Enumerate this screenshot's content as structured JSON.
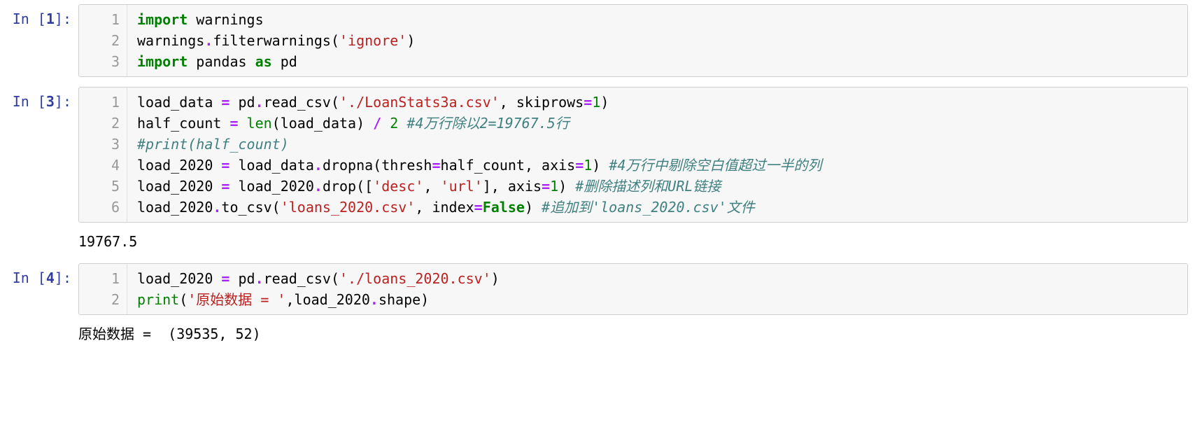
{
  "cells": [
    {
      "prompt_prefix": "In [",
      "prompt_num": "1",
      "prompt_suffix": "]:",
      "gutter": [
        "1",
        "2",
        "3"
      ],
      "tokens": [
        [
          [
            "kw",
            "import"
          ],
          [
            "id",
            " warnings"
          ]
        ],
        [
          [
            "id",
            "warnings"
          ],
          [
            "op",
            "."
          ],
          [
            "id",
            "filterwarnings"
          ],
          [
            "id",
            "("
          ],
          [
            "str",
            "'ignore'"
          ],
          [
            "id",
            ")"
          ]
        ],
        [
          [
            "kw",
            "import"
          ],
          [
            "id",
            " pandas "
          ],
          [
            "kw",
            "as"
          ],
          [
            "id",
            " pd"
          ]
        ]
      ],
      "output": null
    },
    {
      "prompt_prefix": "In [",
      "prompt_num": "3",
      "prompt_suffix": "]:",
      "gutter": [
        "1",
        "2",
        "3",
        "4",
        "5",
        "6"
      ],
      "tokens": [
        [
          [
            "id",
            "load_data "
          ],
          [
            "op",
            "="
          ],
          [
            "id",
            " pd"
          ],
          [
            "op",
            "."
          ],
          [
            "id",
            "read_csv("
          ],
          [
            "str",
            "'./LoanStats3a.csv'"
          ],
          [
            "id",
            ", skiprows"
          ],
          [
            "op",
            "="
          ],
          [
            "num",
            "1"
          ],
          [
            "id",
            ")"
          ]
        ],
        [
          [
            "id",
            "half_count "
          ],
          [
            "op",
            "="
          ],
          [
            "id",
            " "
          ],
          [
            "bi",
            "len"
          ],
          [
            "id",
            "(load_data) "
          ],
          [
            "op",
            "/"
          ],
          [
            "id",
            " "
          ],
          [
            "num",
            "2"
          ],
          [
            "id",
            " "
          ],
          [
            "cm",
            "#4万行除以2=19767.5行"
          ]
        ],
        [
          [
            "cm",
            "#print(half_count)"
          ]
        ],
        [
          [
            "id",
            "load_2020 "
          ],
          [
            "op",
            "="
          ],
          [
            "id",
            " load_data"
          ],
          [
            "op",
            "."
          ],
          [
            "id",
            "dropna(thresh"
          ],
          [
            "op",
            "="
          ],
          [
            "id",
            "half_count, axis"
          ],
          [
            "op",
            "="
          ],
          [
            "num",
            "1"
          ],
          [
            "id",
            ") "
          ],
          [
            "cm",
            "#4万行中剔除空白值超过一半的列"
          ]
        ],
        [
          [
            "id",
            "load_2020 "
          ],
          [
            "op",
            "="
          ],
          [
            "id",
            " load_2020"
          ],
          [
            "op",
            "."
          ],
          [
            "id",
            "drop(["
          ],
          [
            "str",
            "'desc'"
          ],
          [
            "id",
            ", "
          ],
          [
            "str",
            "'url'"
          ],
          [
            "id",
            "], axis"
          ],
          [
            "op",
            "="
          ],
          [
            "num",
            "1"
          ],
          [
            "id",
            ") "
          ],
          [
            "cm",
            "#删除描述列和URL链接"
          ]
        ],
        [
          [
            "id",
            "load_2020"
          ],
          [
            "op",
            "."
          ],
          [
            "id",
            "to_csv("
          ],
          [
            "str",
            "'loans_2020.csv'"
          ],
          [
            "id",
            ", index"
          ],
          [
            "op",
            "="
          ],
          [
            "bool",
            "False"
          ],
          [
            "id",
            ") "
          ],
          [
            "cm",
            "#追加到'loans_2020.csv'文件"
          ]
        ]
      ],
      "output": "19767.5"
    },
    {
      "prompt_prefix": "In [",
      "prompt_num": "4",
      "prompt_suffix": "]:",
      "gutter": [
        "1",
        "2"
      ],
      "tokens": [
        [
          [
            "id",
            "load_2020 "
          ],
          [
            "op",
            "="
          ],
          [
            "id",
            " pd"
          ],
          [
            "op",
            "."
          ],
          [
            "id",
            "read_csv("
          ],
          [
            "str",
            "'./loans_2020.csv'"
          ],
          [
            "id",
            ")"
          ]
        ],
        [
          [
            "bi",
            "print"
          ],
          [
            "id",
            "("
          ],
          [
            "str",
            "'原始数据 = '"
          ],
          [
            "id",
            ",load_2020"
          ],
          [
            "op",
            "."
          ],
          [
            "id",
            "shape)"
          ]
        ]
      ],
      "output": "原始数据 =  (39535, 52)"
    }
  ]
}
